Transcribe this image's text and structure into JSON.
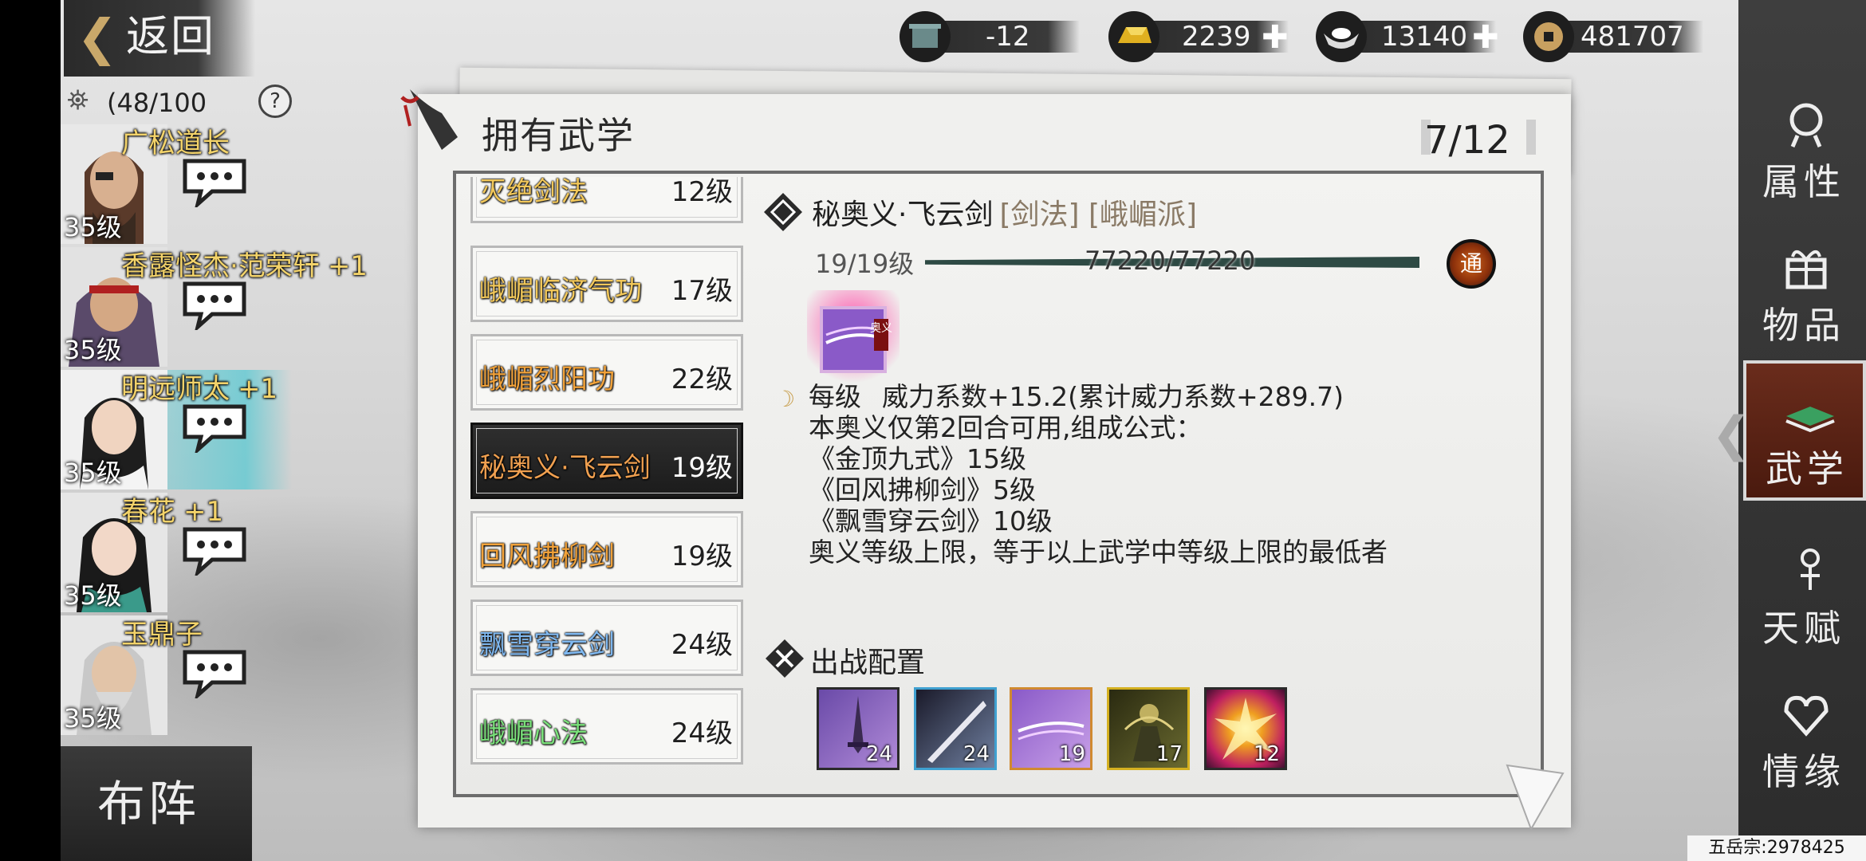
{
  "header": {
    "back_label": "返回",
    "team_count": "(48/100",
    "help": "?"
  },
  "currencies": [
    {
      "name": "stamina",
      "icon": "pot-icon",
      "value": "-12",
      "has_plus": false
    },
    {
      "name": "gold",
      "icon": "gold-bar-icon",
      "value": "2239",
      "has_plus": true
    },
    {
      "name": "silver",
      "icon": "silver-ingot-icon",
      "value": "13140",
      "has_plus": true
    },
    {
      "name": "copper",
      "icon": "coin-icon",
      "value": "481707",
      "has_plus": false
    }
  ],
  "characters": [
    {
      "name": "广松道长",
      "plus": "",
      "level": "35级"
    },
    {
      "name": "香露怪杰·范荣轩",
      "plus": "+1",
      "level": "35级"
    },
    {
      "name": "明远师太",
      "plus": "+1",
      "level": "35级"
    },
    {
      "name": "春花",
      "plus": "+1",
      "level": "35级"
    },
    {
      "name": "玉鼎子",
      "plus": "",
      "level": "35级"
    }
  ],
  "formation_label": "布阵",
  "panel": {
    "title": "拥有武学",
    "count": "7/12"
  },
  "skills": [
    {
      "name": "灭绝剑法",
      "level": "12级",
      "color": "#f1c75a"
    },
    {
      "name": "峨嵋临济气功",
      "level": "17级",
      "color": "#f1c75a"
    },
    {
      "name": "峨嵋烈阳功",
      "level": "22级",
      "color": "#f1a23a"
    },
    {
      "name": "秘奥义·飞云剑",
      "level": "19级",
      "color": "#f0a050",
      "selected": true
    },
    {
      "name": "回风拂柳剑",
      "level": "19级",
      "color": "#f1a23a"
    },
    {
      "name": "飘雪穿云剑",
      "level": "24级",
      "color": "#7fb8f0"
    },
    {
      "name": "峨嵋心法",
      "level": "24级",
      "color": "#7ae07a"
    }
  ],
  "detail": {
    "name": "秘奥义·飞云剑",
    "tags": "[剑法] [峨嵋派]",
    "level": "19/19级",
    "exp": "77220/77220",
    "badge": "通",
    "icon_tag": "奥义",
    "per_level_label": "每级",
    "per_level_value": "威力系数+15.2(累计威力系数+289.7)",
    "lines": [
      "本奥义仅第2回合可用,组成公式：",
      "《金顶九式》15级",
      "《回风拂柳剑》5级",
      "《飘雪穿云剑》10级",
      "奥义等级上限，等于以上武学中等级上限的最低者"
    ]
  },
  "battle_config": {
    "title": "出战配置",
    "slots": [
      {
        "num": "24",
        "icon": "sword-purple-icon",
        "border": "#2a2a2a"
      },
      {
        "num": "24",
        "icon": "blade-icon",
        "border": "#3fa0d0"
      },
      {
        "num": "19",
        "icon": "flying-cloud-sword-icon",
        "border": "#d08a30"
      },
      {
        "num": "17",
        "icon": "warrior-icon",
        "border": "#d4b020"
      },
      {
        "num": "12",
        "icon": "explosion-icon",
        "border": "#2a2a2a"
      }
    ]
  },
  "nav": [
    {
      "label": "属性",
      "icon": "attribute-icon"
    },
    {
      "label": "物品",
      "icon": "gift-box-icon"
    },
    {
      "label": "武学",
      "icon": "book-icon",
      "active": true
    },
    {
      "label": "天赋",
      "icon": "talent-icon"
    },
    {
      "label": "情缘",
      "icon": "heart-knot-icon"
    }
  ],
  "footer": "五岳宗:2978425"
}
